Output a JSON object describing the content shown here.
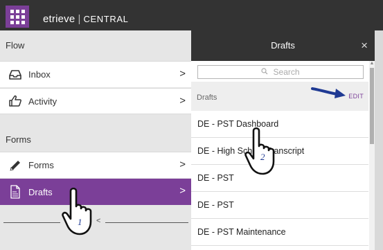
{
  "header": {
    "apps_icon": "grid-icon",
    "brand_logo": "etrieve",
    "brand_separator": "|",
    "brand_product": "CENTRAL"
  },
  "left": {
    "flow_heading": "Flow",
    "flow_items": [
      {
        "label": "Inbox",
        "icon": "inbox-icon"
      },
      {
        "label": "Activity",
        "icon": "thumbs-up-icon"
      }
    ],
    "forms_heading": "Forms",
    "forms_items": [
      {
        "label": "Forms",
        "icon": "pencil-icon"
      },
      {
        "label": "Drafts",
        "icon": "document-icon"
      }
    ],
    "chevron": ">",
    "pager_arrow": "<"
  },
  "drawer": {
    "title": "Drafts",
    "close": "×",
    "search_placeholder": "Search",
    "list_label": "Drafts",
    "edit_label": "EDIT",
    "items": [
      "DE - PST Dashboard",
      "DE - High School Transcript",
      "DE - PST",
      "DE - PST",
      "DE - PST Maintenance"
    ]
  },
  "annotations": {
    "step1": "1",
    "step2": "2"
  },
  "colors": {
    "accent": "#7b3f98",
    "topbar": "#333333",
    "annotation_blue": "#1f3a93"
  }
}
